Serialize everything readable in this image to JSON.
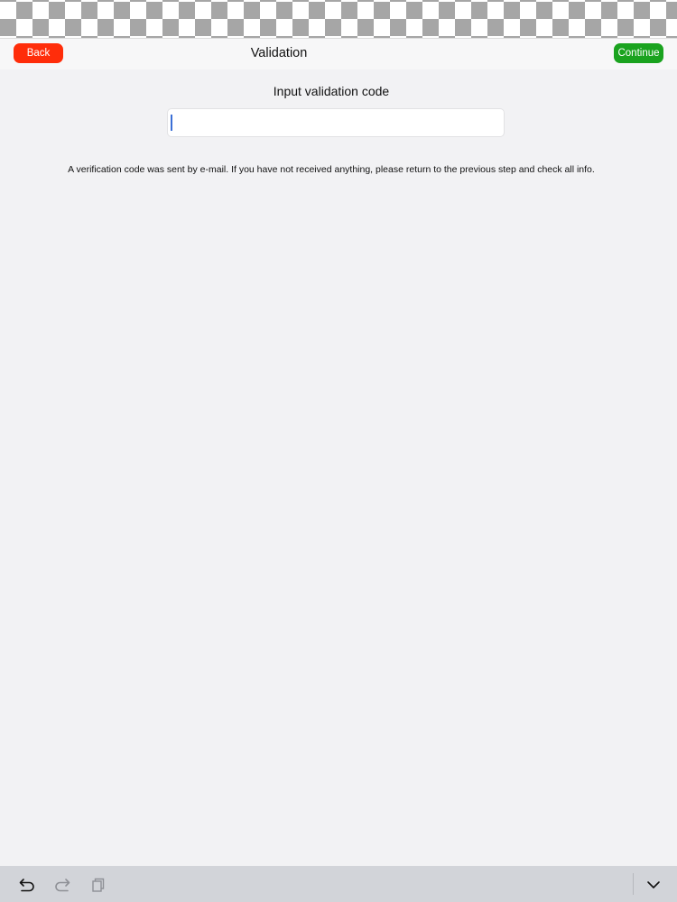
{
  "nav": {
    "title": "Validation",
    "back_label": "Back",
    "continue_label": "Continue"
  },
  "form": {
    "prompt_label": "Input validation code",
    "code_value": "",
    "hint": "A verification code was sent by e-mail. If you have not received anything, please return to the previous step and check all info."
  },
  "accessory_bar": {
    "icons": [
      "undo-icon",
      "redo-icon",
      "paste-icon",
      "chevron-down-icon"
    ]
  },
  "colors": {
    "back_button": "#ff2d0a",
    "continue_button": "#1aa31f",
    "background": "#f2f2f4",
    "caret": "#3b6fd6"
  }
}
